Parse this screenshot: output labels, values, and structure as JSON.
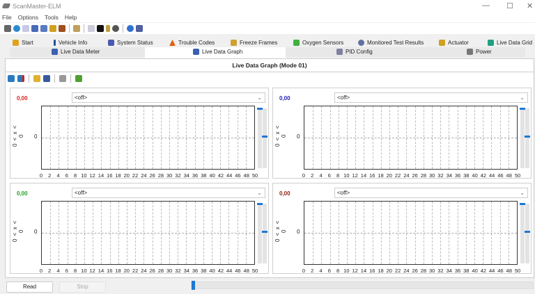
{
  "window": {
    "title": "ScanMaster-ELM"
  },
  "menu": [
    "File",
    "Options",
    "Tools",
    "Help"
  ],
  "tabs_row1": [
    {
      "label": "Start",
      "color": "#e0a020"
    },
    {
      "label": "Vehicle Info",
      "color": "#2050a0"
    },
    {
      "label": "System Status",
      "color": "#4a5ab0"
    },
    {
      "label": "Trouble Codes",
      "color": "#e06010"
    },
    {
      "label": "Freeze Frames",
      "color": "#d0a030"
    },
    {
      "label": "Oxygen Sensors",
      "color": "#40b040"
    },
    {
      "label": "Monitored Test Results",
      "color": "#6070a0"
    },
    {
      "label": "Actuator",
      "color": "#d0a020"
    },
    {
      "label": "Live Data Grid",
      "color": "#20a080"
    }
  ],
  "tabs_row2": [
    {
      "label": "Live Data Meter",
      "color": "#3a60b0"
    },
    {
      "label": "Live Data Graph",
      "color": "#3a60b0",
      "active": true
    },
    {
      "label": "PID Config",
      "color": "#8080a0"
    },
    {
      "label": "Power",
      "color": "#777"
    }
  ],
  "main": {
    "title": "Live Data Graph (Mode 01)"
  },
  "graphs": [
    {
      "value": "0,00",
      "value_color": "#e02020",
      "pid": "<off>",
      "axis_label": "0 < x < 0",
      "y_tick": "0"
    },
    {
      "value": "0,00",
      "value_color": "#2020c0",
      "pid": "<off>",
      "axis_label": "0 < x < 0",
      "y_tick": "0"
    },
    {
      "value": "0,00",
      "value_color": "#20a020",
      "pid": "<off>",
      "axis_label": "0 < x < 0",
      "y_tick": "0"
    },
    {
      "value": "0,00",
      "value_color": "#902010",
      "pid": "<off>",
      "axis_label": "0 < x < 0",
      "y_tick": "0"
    }
  ],
  "x_ticks": [
    "0",
    "2",
    "4",
    "6",
    "8",
    "10",
    "12",
    "14",
    "16",
    "18",
    "20",
    "22",
    "24",
    "26",
    "28",
    "30",
    "32",
    "34",
    "36",
    "38",
    "40",
    "42",
    "44",
    "46",
    "48",
    "50"
  ],
  "buttons": {
    "read": "Read",
    "stop": "Stop"
  },
  "progress": 0
}
